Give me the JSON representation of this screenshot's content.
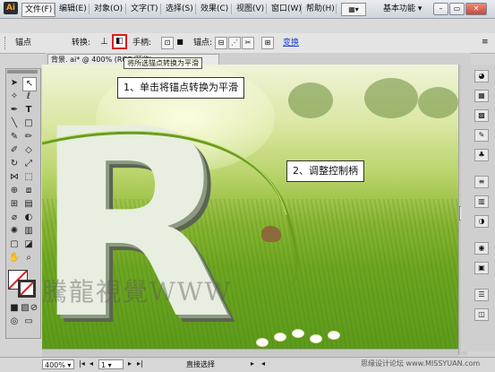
{
  "app": {
    "logo": "Ai",
    "workspace": "基本功能"
  },
  "menu": [
    "文件(F)",
    "编辑(E)",
    "对象(O)",
    "文字(T)",
    "选择(S)",
    "效果(C)",
    "视图(V)",
    "窗口(W)",
    "帮助(H)"
  ],
  "control": {
    "anchor_label": "锚点",
    "convert_label": "转换:",
    "handle_label": "手柄:",
    "anchors_label": "锚点:",
    "transform_link": "变换",
    "tooltip": "将所选锚点转换为平滑"
  },
  "document": {
    "tab_title": "背景. ai* @ 400% (RGB/预览)"
  },
  "callouts": {
    "step1": "1、单击将锚点转换为平滑",
    "step2": "2、调整控制柄"
  },
  "artwork": {
    "letter": "R",
    "watermark": "騰龍視覺WWW"
  },
  "status": {
    "zoom": "400%",
    "page": "1",
    "tool": "直接选择"
  },
  "site_watermark": "思缘设计论坛 www.MISSYUAN.com",
  "colors": {
    "highlight": "#d42020",
    "link": "#1a3fcc"
  }
}
